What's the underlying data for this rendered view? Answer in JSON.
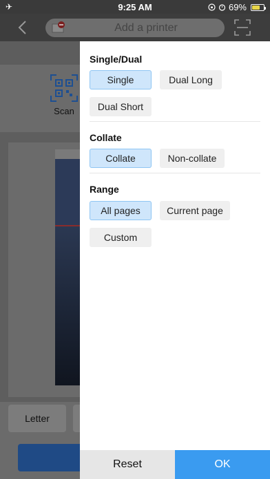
{
  "status_bar": {
    "time": "9:25 AM",
    "battery_percent": "69%",
    "battery_level": 0.69,
    "icons": [
      "airplane-mode-icon",
      "lock-rotation-icon",
      "alarm-icon",
      "battery-charging-icon"
    ]
  },
  "nav": {
    "search_placeholder": "Add a printer",
    "icons": [
      "back-icon",
      "printer-icon",
      "scan-frame-icon"
    ]
  },
  "background": {
    "scan_label": "Scan",
    "paper_size": "Letter"
  },
  "drawer": {
    "sections": [
      {
        "title": "Single/Dual",
        "options": [
          {
            "label": "Single",
            "selected": true
          },
          {
            "label": "Dual Long",
            "selected": false
          },
          {
            "label": "Dual Short",
            "selected": false
          }
        ]
      },
      {
        "title": "Collate",
        "options": [
          {
            "label": "Collate",
            "selected": true
          },
          {
            "label": "Non-collate",
            "selected": false
          }
        ]
      },
      {
        "title": "Range",
        "options": [
          {
            "label": "All pages",
            "selected": true
          },
          {
            "label": "Current page",
            "selected": false
          },
          {
            "label": "Custom",
            "selected": false
          }
        ]
      }
    ],
    "footer": {
      "reset_label": "Reset",
      "ok_label": "OK"
    }
  },
  "colors": {
    "accent": "#3a9bf0",
    "selected_bg": "#cfe6fb",
    "selected_border": "#8ec5f3"
  }
}
